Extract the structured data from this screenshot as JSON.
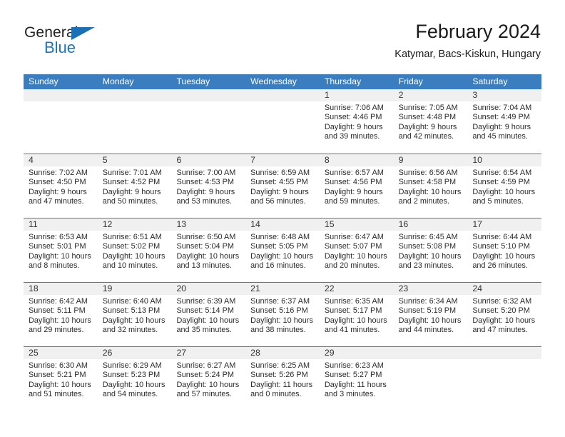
{
  "brand": {
    "name_part1": "General",
    "name_part2": "Blue",
    "accent_color": "#1b75bb",
    "logo_icon": "triangle-icon"
  },
  "header": {
    "title": "February 2024",
    "subtitle": "Katymar, Bacs-Kiskun, Hungary"
  },
  "calendar": {
    "header_bg": "#3a7ebf",
    "weekdays": [
      "Sunday",
      "Monday",
      "Tuesday",
      "Wednesday",
      "Thursday",
      "Friday",
      "Saturday"
    ],
    "weeks": [
      [
        {
          "day": "",
          "sunrise": "",
          "sunset": "",
          "daylight_line1": "",
          "daylight_line2": "",
          "empty": true
        },
        {
          "day": "",
          "sunrise": "",
          "sunset": "",
          "daylight_line1": "",
          "daylight_line2": "",
          "empty": true
        },
        {
          "day": "",
          "sunrise": "",
          "sunset": "",
          "daylight_line1": "",
          "daylight_line2": "",
          "empty": true
        },
        {
          "day": "",
          "sunrise": "",
          "sunset": "",
          "daylight_line1": "",
          "daylight_line2": "",
          "empty": true
        },
        {
          "day": "1",
          "sunrise": "Sunrise: 7:06 AM",
          "sunset": "Sunset: 4:46 PM",
          "daylight_line1": "Daylight: 9 hours",
          "daylight_line2": "and 39 minutes.",
          "empty": false
        },
        {
          "day": "2",
          "sunrise": "Sunrise: 7:05 AM",
          "sunset": "Sunset: 4:48 PM",
          "daylight_line1": "Daylight: 9 hours",
          "daylight_line2": "and 42 minutes.",
          "empty": false
        },
        {
          "day": "3",
          "sunrise": "Sunrise: 7:04 AM",
          "sunset": "Sunset: 4:49 PM",
          "daylight_line1": "Daylight: 9 hours",
          "daylight_line2": "and 45 minutes.",
          "empty": false
        }
      ],
      [
        {
          "day": "4",
          "sunrise": "Sunrise: 7:02 AM",
          "sunset": "Sunset: 4:50 PM",
          "daylight_line1": "Daylight: 9 hours",
          "daylight_line2": "and 47 minutes.",
          "empty": false
        },
        {
          "day": "5",
          "sunrise": "Sunrise: 7:01 AM",
          "sunset": "Sunset: 4:52 PM",
          "daylight_line1": "Daylight: 9 hours",
          "daylight_line2": "and 50 minutes.",
          "empty": false
        },
        {
          "day": "6",
          "sunrise": "Sunrise: 7:00 AM",
          "sunset": "Sunset: 4:53 PM",
          "daylight_line1": "Daylight: 9 hours",
          "daylight_line2": "and 53 minutes.",
          "empty": false
        },
        {
          "day": "7",
          "sunrise": "Sunrise: 6:59 AM",
          "sunset": "Sunset: 4:55 PM",
          "daylight_line1": "Daylight: 9 hours",
          "daylight_line2": "and 56 minutes.",
          "empty": false
        },
        {
          "day": "8",
          "sunrise": "Sunrise: 6:57 AM",
          "sunset": "Sunset: 4:56 PM",
          "daylight_line1": "Daylight: 9 hours",
          "daylight_line2": "and 59 minutes.",
          "empty": false
        },
        {
          "day": "9",
          "sunrise": "Sunrise: 6:56 AM",
          "sunset": "Sunset: 4:58 PM",
          "daylight_line1": "Daylight: 10 hours",
          "daylight_line2": "and 2 minutes.",
          "empty": false
        },
        {
          "day": "10",
          "sunrise": "Sunrise: 6:54 AM",
          "sunset": "Sunset: 4:59 PM",
          "daylight_line1": "Daylight: 10 hours",
          "daylight_line2": "and 5 minutes.",
          "empty": false
        }
      ],
      [
        {
          "day": "11",
          "sunrise": "Sunrise: 6:53 AM",
          "sunset": "Sunset: 5:01 PM",
          "daylight_line1": "Daylight: 10 hours",
          "daylight_line2": "and 8 minutes.",
          "empty": false
        },
        {
          "day": "12",
          "sunrise": "Sunrise: 6:51 AM",
          "sunset": "Sunset: 5:02 PM",
          "daylight_line1": "Daylight: 10 hours",
          "daylight_line2": "and 10 minutes.",
          "empty": false
        },
        {
          "day": "13",
          "sunrise": "Sunrise: 6:50 AM",
          "sunset": "Sunset: 5:04 PM",
          "daylight_line1": "Daylight: 10 hours",
          "daylight_line2": "and 13 minutes.",
          "empty": false
        },
        {
          "day": "14",
          "sunrise": "Sunrise: 6:48 AM",
          "sunset": "Sunset: 5:05 PM",
          "daylight_line1": "Daylight: 10 hours",
          "daylight_line2": "and 16 minutes.",
          "empty": false
        },
        {
          "day": "15",
          "sunrise": "Sunrise: 6:47 AM",
          "sunset": "Sunset: 5:07 PM",
          "daylight_line1": "Daylight: 10 hours",
          "daylight_line2": "and 20 minutes.",
          "empty": false
        },
        {
          "day": "16",
          "sunrise": "Sunrise: 6:45 AM",
          "sunset": "Sunset: 5:08 PM",
          "daylight_line1": "Daylight: 10 hours",
          "daylight_line2": "and 23 minutes.",
          "empty": false
        },
        {
          "day": "17",
          "sunrise": "Sunrise: 6:44 AM",
          "sunset": "Sunset: 5:10 PM",
          "daylight_line1": "Daylight: 10 hours",
          "daylight_line2": "and 26 minutes.",
          "empty": false
        }
      ],
      [
        {
          "day": "18",
          "sunrise": "Sunrise: 6:42 AM",
          "sunset": "Sunset: 5:11 PM",
          "daylight_line1": "Daylight: 10 hours",
          "daylight_line2": "and 29 minutes.",
          "empty": false
        },
        {
          "day": "19",
          "sunrise": "Sunrise: 6:40 AM",
          "sunset": "Sunset: 5:13 PM",
          "daylight_line1": "Daylight: 10 hours",
          "daylight_line2": "and 32 minutes.",
          "empty": false
        },
        {
          "day": "20",
          "sunrise": "Sunrise: 6:39 AM",
          "sunset": "Sunset: 5:14 PM",
          "daylight_line1": "Daylight: 10 hours",
          "daylight_line2": "and 35 minutes.",
          "empty": false
        },
        {
          "day": "21",
          "sunrise": "Sunrise: 6:37 AM",
          "sunset": "Sunset: 5:16 PM",
          "daylight_line1": "Daylight: 10 hours",
          "daylight_line2": "and 38 minutes.",
          "empty": false
        },
        {
          "day": "22",
          "sunrise": "Sunrise: 6:35 AM",
          "sunset": "Sunset: 5:17 PM",
          "daylight_line1": "Daylight: 10 hours",
          "daylight_line2": "and 41 minutes.",
          "empty": false
        },
        {
          "day": "23",
          "sunrise": "Sunrise: 6:34 AM",
          "sunset": "Sunset: 5:19 PM",
          "daylight_line1": "Daylight: 10 hours",
          "daylight_line2": "and 44 minutes.",
          "empty": false
        },
        {
          "day": "24",
          "sunrise": "Sunrise: 6:32 AM",
          "sunset": "Sunset: 5:20 PM",
          "daylight_line1": "Daylight: 10 hours",
          "daylight_line2": "and 47 minutes.",
          "empty": false
        }
      ],
      [
        {
          "day": "25",
          "sunrise": "Sunrise: 6:30 AM",
          "sunset": "Sunset: 5:21 PM",
          "daylight_line1": "Daylight: 10 hours",
          "daylight_line2": "and 51 minutes.",
          "empty": false
        },
        {
          "day": "26",
          "sunrise": "Sunrise: 6:29 AM",
          "sunset": "Sunset: 5:23 PM",
          "daylight_line1": "Daylight: 10 hours",
          "daylight_line2": "and 54 minutes.",
          "empty": false
        },
        {
          "day": "27",
          "sunrise": "Sunrise: 6:27 AM",
          "sunset": "Sunset: 5:24 PM",
          "daylight_line1": "Daylight: 10 hours",
          "daylight_line2": "and 57 minutes.",
          "empty": false
        },
        {
          "day": "28",
          "sunrise": "Sunrise: 6:25 AM",
          "sunset": "Sunset: 5:26 PM",
          "daylight_line1": "Daylight: 11 hours",
          "daylight_line2": "and 0 minutes.",
          "empty": false
        },
        {
          "day": "29",
          "sunrise": "Sunrise: 6:23 AM",
          "sunset": "Sunset: 5:27 PM",
          "daylight_line1": "Daylight: 11 hours",
          "daylight_line2": "and 3 minutes.",
          "empty": false
        },
        {
          "day": "",
          "sunrise": "",
          "sunset": "",
          "daylight_line1": "",
          "daylight_line2": "",
          "empty": true
        },
        {
          "day": "",
          "sunrise": "",
          "sunset": "",
          "daylight_line1": "",
          "daylight_line2": "",
          "empty": true
        }
      ]
    ]
  }
}
